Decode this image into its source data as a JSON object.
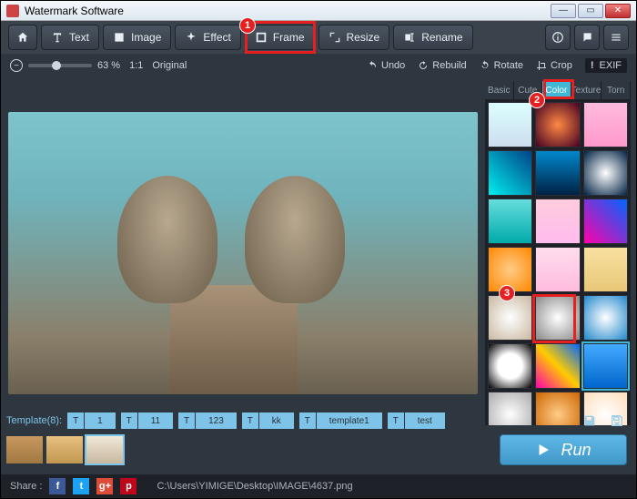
{
  "window": {
    "title": "Watermark Software"
  },
  "toolbar": {
    "text": "Text",
    "image": "Image",
    "effect": "Effect",
    "frame": "Frame",
    "resize": "Resize",
    "rename": "Rename"
  },
  "subbar": {
    "zoom": "63 %",
    "ratio": "1:1",
    "original": "Original",
    "undo": "Undo",
    "rebuild": "Rebuild",
    "rotate": "Rotate",
    "crop": "Crop",
    "exif": "EXIF"
  },
  "panel": {
    "tabs": [
      "Basic",
      "Cute",
      "Color",
      "Texture",
      "Torn"
    ],
    "active": 2
  },
  "templates": {
    "label": "Template(8):",
    "items": [
      "1",
      "11",
      "123",
      "kk",
      "template1",
      "test"
    ]
  },
  "thumbs": [
    "linear-gradient(#c89860,#a07840)",
    "linear-gradient(#e8c080,#c09850)",
    "linear-gradient(#f0e8d8,#c8b8a0)"
  ],
  "frame_thumbs": [
    "linear-gradient(#dff,#cde)",
    "radial-gradient(#f84,#402)",
    "linear-gradient(#fbd,#f9c)",
    "linear-gradient(45deg,#0ee,#048)",
    "linear-gradient(#08c,#024)",
    "radial-gradient(#fff,#024)",
    "linear-gradient(#6dd,#0aa)",
    "linear-gradient(#fcd,#fbe)",
    "linear-gradient(45deg,#f0a,#06f)",
    "radial-gradient(#fc8,#f80)",
    "linear-gradient(#fde,#fbd)",
    "linear-gradient(#f8e0a0,#e8c878)",
    "radial-gradient(#fff,#c8b8a0)",
    "radial-gradient(#fff,#888)",
    "radial-gradient(#fff,#28c)",
    "radial-gradient(#fff 40%,#000)",
    "linear-gradient(45deg,#f0a,#fc0,#06f)",
    "linear-gradient(#4af,#06c)",
    "radial-gradient(#fff,#aaa)",
    "radial-gradient(#fc8,#c60)",
    "radial-gradient(#fff,#fdb)",
    "radial-gradient(#fce,#f8c)",
    "linear-gradient(#f66,#c00,#ff0)",
    "linear-gradient(#eef,#ccd)"
  ],
  "run": "Run",
  "footer": {
    "share": "Share :",
    "path": "C:\\Users\\YIMIGE\\Desktop\\IMAGE\\4637.png"
  },
  "callouts": {
    "c1": "1",
    "c2": "2",
    "c3": "3"
  },
  "social": {
    "fb": "f",
    "tw": "t",
    "gp": "g+",
    "pi": "p"
  }
}
